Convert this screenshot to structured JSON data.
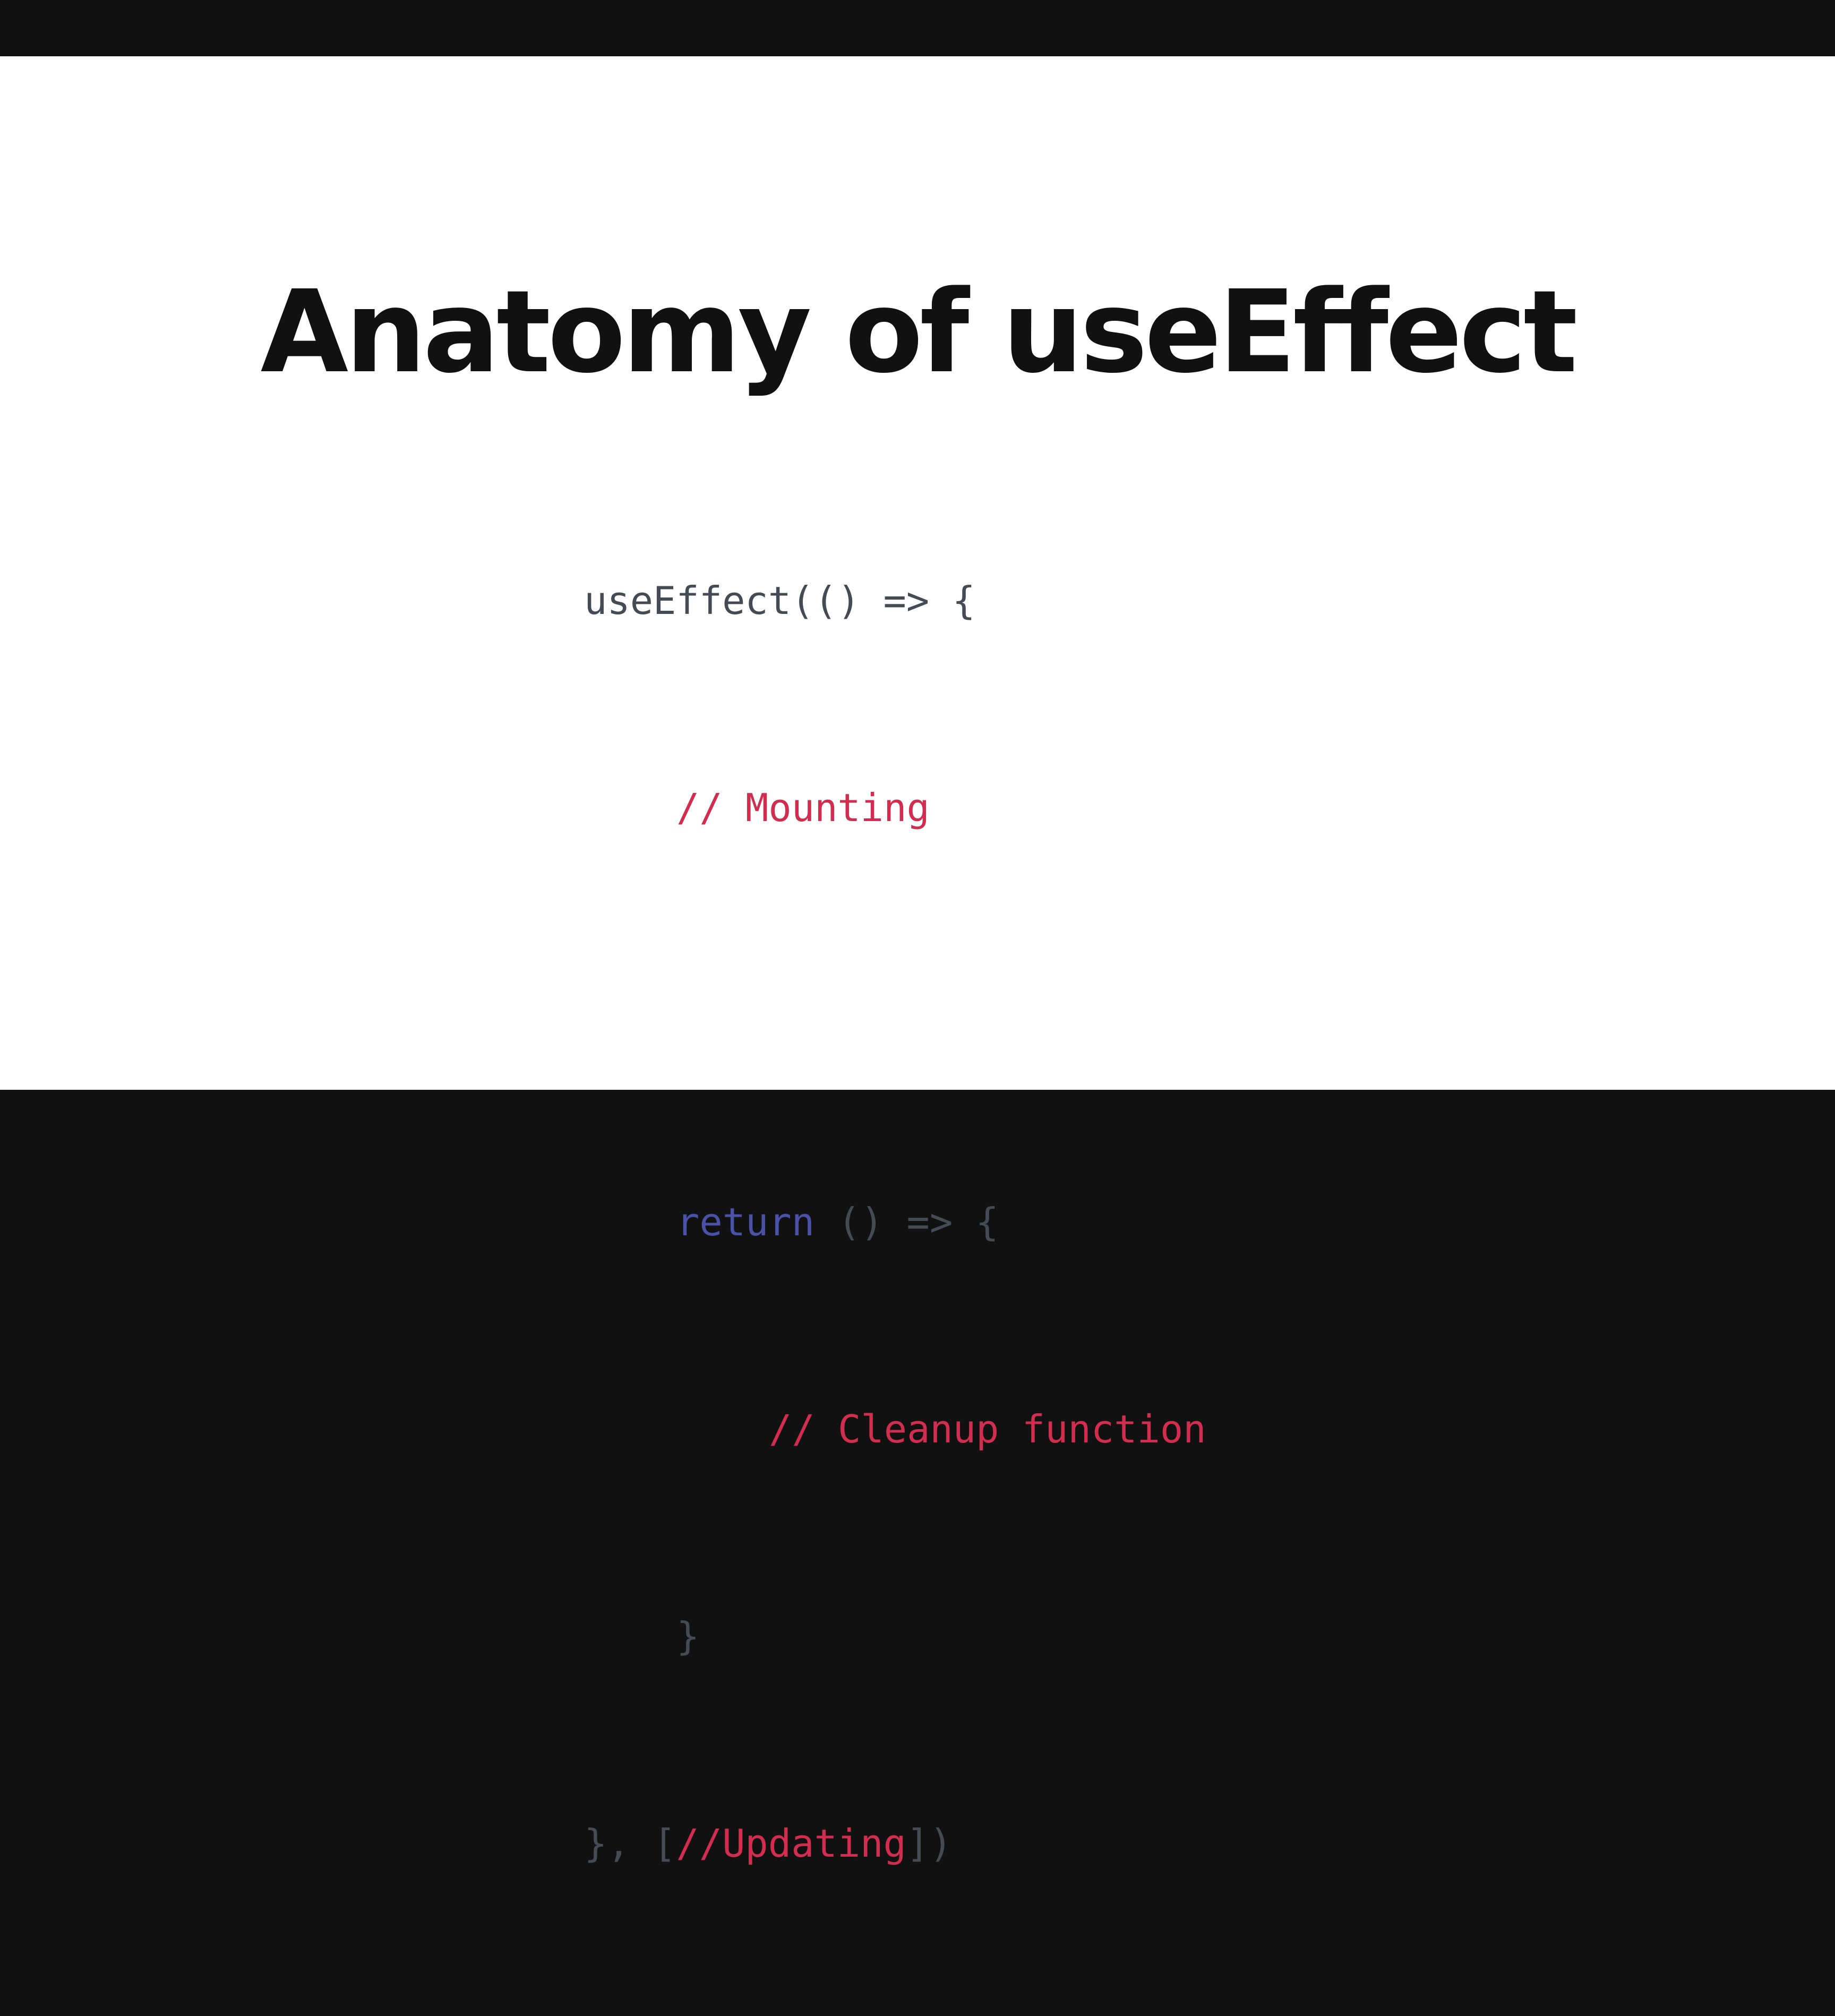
{
  "slide": {
    "title": "Anatomy of useEffect",
    "code": {
      "line1": "useEffect(() => {",
      "line2_comment": "// Mounting",
      "line4_keyword": "return",
      "line4_rest": " () => {",
      "line5_comment": "// Cleanup function",
      "line6": "}",
      "line7_open": "}, [",
      "line7_comment": "//Updating",
      "line7_close": "])"
    },
    "colors": {
      "comment": "#d12e4f",
      "keyword": "#4a52a8",
      "plain": "#454a55",
      "title": "#111111",
      "background": "#ffffff",
      "letterbox": "#111111"
    }
  }
}
